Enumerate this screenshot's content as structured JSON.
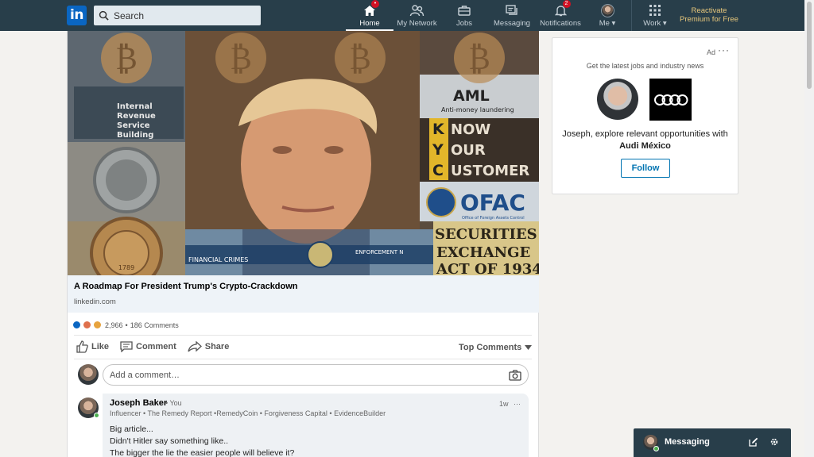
{
  "nav": {
    "logo": "in",
    "search_placeholder": "Search",
    "items": [
      {
        "label": "Home",
        "badge": "•"
      },
      {
        "label": "My Network"
      },
      {
        "label": "Jobs"
      },
      {
        "label": "Messaging"
      },
      {
        "label": "Notifications",
        "badge": "2"
      },
      {
        "label": "Me ▾"
      },
      {
        "label": "Work ▾"
      }
    ],
    "premium": "Reactivate Premium for Free"
  },
  "post": {
    "image_text": {
      "irs": "Internal Revenue Service Building",
      "aml": "AML",
      "aml_sub": "Anti-money laundering",
      "kyc": [
        "NOW",
        "OUR",
        "USTOMER"
      ],
      "kyc_letters": [
        "K",
        "Y",
        "C"
      ],
      "ofac": "OFAC",
      "ofac_sub": "Office of Foreign Assets Control",
      "sec": [
        "SECURITIES",
        "EXCHANGE",
        "ACT OF 1934"
      ],
      "banner_left": "FINANCIAL CRIMES",
      "banner_right": "ENFORCEMENT N",
      "treasury_year": "1789"
    },
    "article_title": "A Roadmap For President Trump's Crypto-Crackdown",
    "article_source": "linkedin.com",
    "reactions_count": "2,966",
    "comments_count": "186 Comments",
    "actions": {
      "like": "Like",
      "comment": "Comment",
      "share": "Share"
    },
    "sort_label": "Top Comments",
    "comment_placeholder": "Add a comment…"
  },
  "comment": {
    "author": "Joseph Baker",
    "you": "• You",
    "headline": "Influencer • The Remedy Report •RemedyCoin • Forgiveness Capital • EvidenceBuilder",
    "time": "1w",
    "more": "···",
    "lines": [
      "Big article...",
      "Didn't Hitler say something like..",
      "The bigger the lie the easier people will believe it?"
    ]
  },
  "ad": {
    "label": "Ad",
    "more": "···",
    "subtitle": "Get the latest jobs and industry news",
    "text_prefix": "Joseph, explore relevant opportunities with",
    "company": "Audi México",
    "follow": "Follow"
  },
  "messaging": {
    "label": "Messaging"
  },
  "colors": {
    "nav_bg": "#283e4a",
    "brand": "#0a66c2",
    "link": "#0073b1",
    "premium": "#e7c77b"
  }
}
